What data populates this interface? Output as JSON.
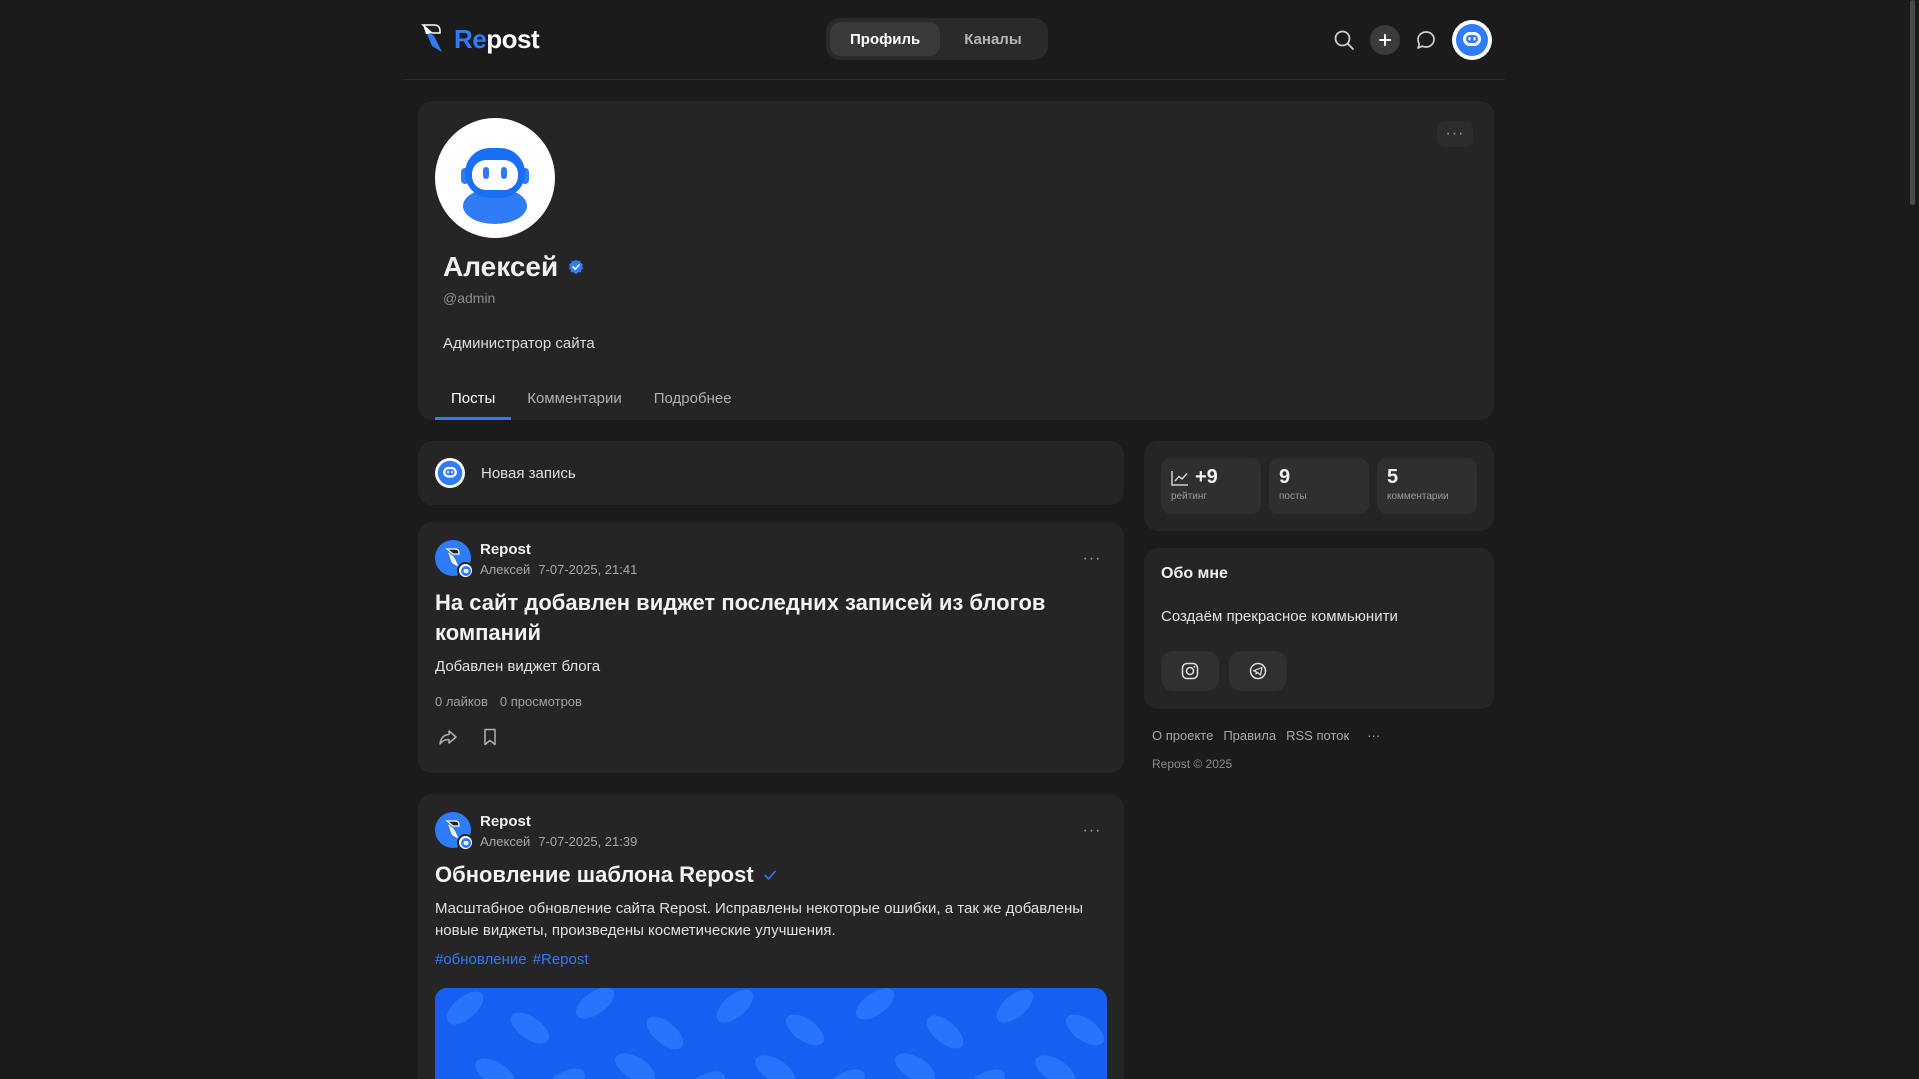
{
  "header": {
    "logo_prefix": "Re",
    "logo_suffix": "post",
    "tabs": [
      {
        "label": "Профиль",
        "active": true
      },
      {
        "label": "Каналы",
        "active": false
      }
    ],
    "icons": [
      "search-icon",
      "plus-icon",
      "chat-icon",
      "user-avatar"
    ]
  },
  "profile": {
    "name": "Алексей",
    "handle": "@admin",
    "bio": "Администратор сайта",
    "tabs": [
      {
        "label": "Посты",
        "active": true
      },
      {
        "label": "Комментарии",
        "active": false
      },
      {
        "label": "Подробнее",
        "active": false
      }
    ],
    "more": "···"
  },
  "new_post": {
    "label": "Новая запись"
  },
  "posts": [
    {
      "source": "Repost",
      "author": "Алексей",
      "date": "7-07-2025, 21:41",
      "title": "На сайт добавлен виджет последних записей из блогов компаний",
      "text": "Добавлен виджет блога",
      "likes": "0 лайков",
      "views": "0 просмотров",
      "more": "···"
    },
    {
      "source": "Repost",
      "author": "Алексей",
      "date": "7-07-2025, 21:39",
      "title": "Обновление шаблона Repost",
      "text": "Масштабное обновление сайта Repost. Исправлены некоторые ошибки, а так же добавлены новые виджеты, произведены косметические улучшения.",
      "tags": [
        "#обновление",
        "#Repost"
      ],
      "more": "···"
    }
  ],
  "stats": [
    {
      "value": "+9",
      "label": "рейтинг"
    },
    {
      "value": "9",
      "label": "посты"
    },
    {
      "value": "5",
      "label": "комментарии"
    }
  ],
  "about": {
    "title": "Обо мне",
    "text": "Создаём прекрасное коммьюнити",
    "socials": [
      "instagram-icon",
      "telegram-icon"
    ]
  },
  "footer": {
    "links": [
      "О проекте",
      "Правила",
      "RSS поток"
    ],
    "more": "···",
    "copyright": "Repost © 2025"
  },
  "colors": {
    "accent": "#2f7cf6",
    "background": "#1b1b1b",
    "card": "#252525"
  }
}
